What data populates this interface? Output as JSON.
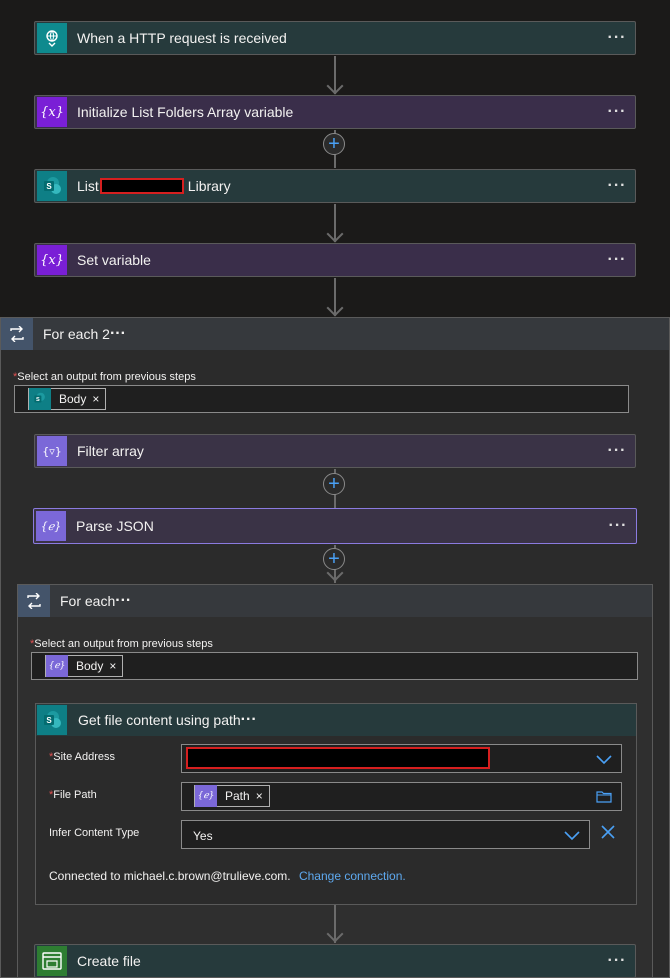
{
  "steps": {
    "http": {
      "title": "When a HTTP request is received"
    },
    "init_var": {
      "title": "Initialize List Folders Array variable"
    },
    "list_lib": {
      "title_prefix": "List",
      "title_suffix": "Library"
    },
    "set_var": {
      "title": "Set variable"
    }
  },
  "for_each_2": {
    "title": "For each 2",
    "select_label": "Select an output from previous steps",
    "required_mark": "*",
    "token_label": "Body",
    "token_remove": "×",
    "filter_array": {
      "title": "Filter array"
    },
    "parse_json": {
      "title": "Parse JSON"
    },
    "for_each": {
      "title": "For each",
      "select_label": "Select an output from previous steps",
      "token_label": "Body",
      "token_remove": "×",
      "get_file": {
        "title": "Get file content using path",
        "site_address_label": "Site Address",
        "file_path_label": "File Path",
        "file_path_token": "Path",
        "file_path_remove": "×",
        "infer_label": "Infer Content Type",
        "infer_value": "Yes",
        "connected_text": "Connected to michael.c.brown@trulieve.com.",
        "change_connection": "Change connection."
      }
    }
  },
  "create_file": {
    "title": "Create file"
  },
  "colors": {
    "accent_blue": "#4aa0f5",
    "redaction_border": "#d61f1f",
    "teal_icon": "#0e7f86",
    "purple_icon": "#7a1fd6",
    "violet_icon": "#7b68d8"
  }
}
